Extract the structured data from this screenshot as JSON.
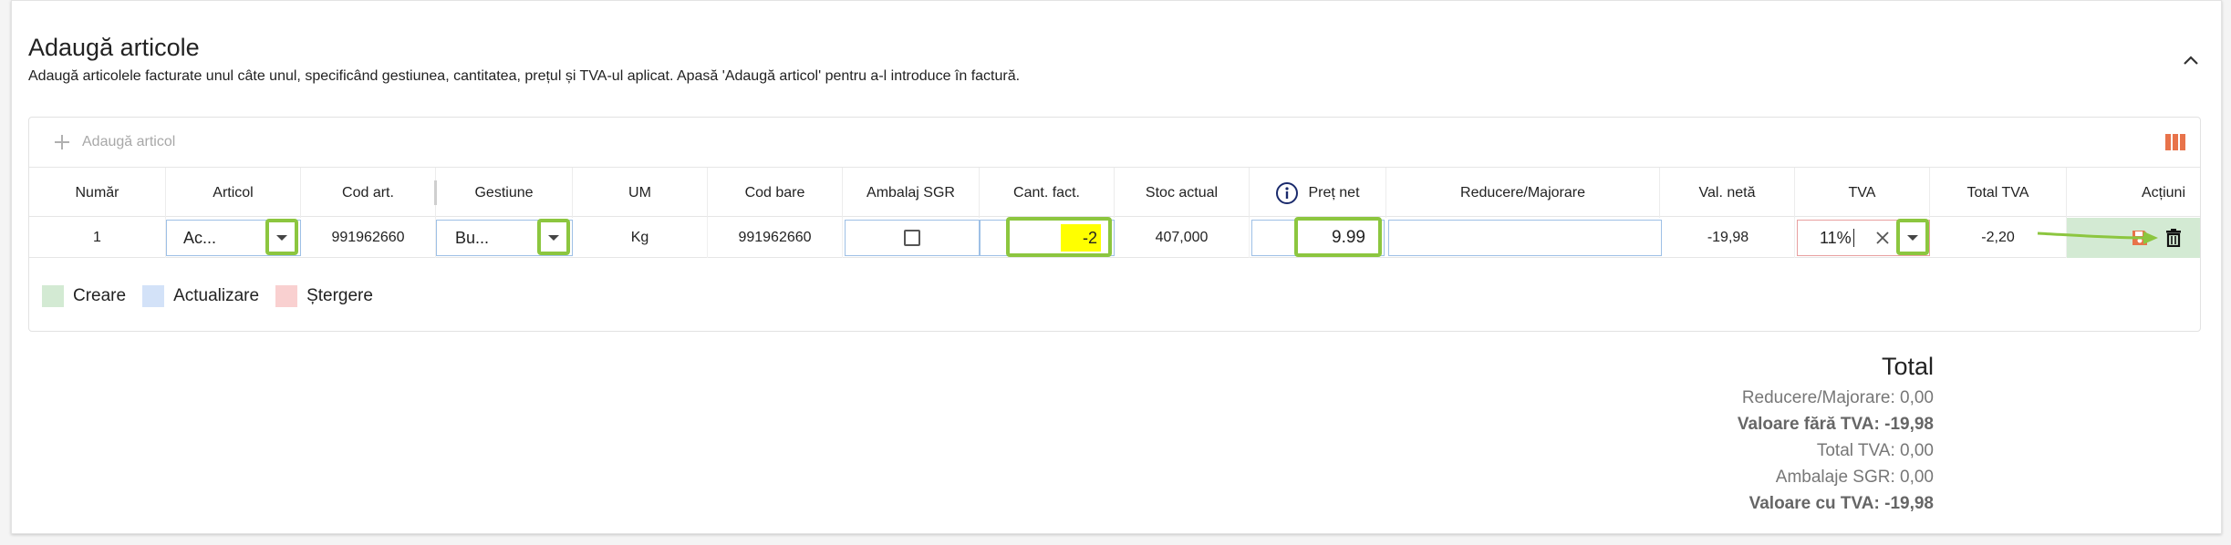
{
  "section": {
    "title": "Adaugă articole",
    "description": "Adaugă articolele facturate unul câte unul, specificând gestiunea, cantitatea, prețul și TVA-ul aplicat. Apasă 'Adaugă articol' pentru a-l introduce în factură."
  },
  "toolbar": {
    "add_label": "Adaugă articol"
  },
  "columns": {
    "numar": "Număr",
    "articol": "Articol",
    "cod_art": "Cod art.",
    "gestiune": "Gestiune",
    "um": "UM",
    "cod_bare": "Cod bare",
    "ambalaj_sgr": "Ambalaj SGR",
    "cant_fact": "Cant. fact.",
    "stoc_actual": "Stoc actual",
    "pret_net": "Preț net",
    "reducere": "Reducere/Majorare",
    "val_neta": "Val. netă",
    "tva": "TVA",
    "total_tva": "Total TVA",
    "actiuni": "Acțiuni"
  },
  "row": {
    "numar": "1",
    "articol": "Ac...",
    "cod_art": "991962660",
    "gestiune": "Bu...",
    "um": "Kg",
    "cod_bare": "991962660",
    "ambalaj_sgr_checked": false,
    "cant_fact": "-2",
    "stoc_actual": "407,000",
    "pret_net": "9.99",
    "reducere": "",
    "val_neta": "-19,98",
    "tva": "11%",
    "total_tva": "-2,20"
  },
  "legend": [
    {
      "label": "Creare",
      "color": "#d3ead3"
    },
    {
      "label": "Actualizare",
      "color": "#d3e2f8"
    },
    {
      "label": "Ștergere",
      "color": "#f9d0d0"
    }
  ],
  "totals": {
    "title": "Total",
    "reducere": "Reducere/Majorare: 0,00",
    "fara_tva": "Valoare fără TVA: -19,98",
    "total_tva": "Total TVA: 0,00",
    "ambalaje": "Ambalaje SGR: 0,00",
    "cu_tva": "Valoare cu TVA: -19,98"
  },
  "colors": {
    "highlight_green": "#8cc63f",
    "row_action_bg": "#d3ead3",
    "cant_highlight": "#ffff00",
    "save_icon": "#e8734a",
    "columns_icon": "#e8734a",
    "tva_border": "#e8a0a0"
  },
  "icons": [
    "plus-icon",
    "columns-icon",
    "chevron-up-icon",
    "info-icon",
    "chevron-down-icon",
    "clear-icon",
    "save-icon",
    "trash-icon"
  ]
}
